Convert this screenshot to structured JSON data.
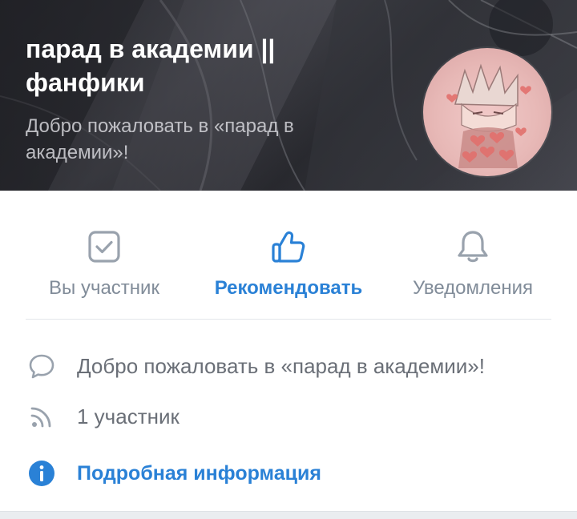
{
  "header": {
    "title": "парад в академии || фанфики",
    "subtitle": "Добро пожаловать в «парад в академии»!"
  },
  "actions": {
    "member_label": "Вы участник",
    "recommend_label": "Рекомендовать",
    "notifications_label": "Уведомления"
  },
  "info": {
    "description": "Добро пожаловать в «парад в академии»!",
    "members": "1 участник",
    "more_info": "Подробная информация"
  },
  "colors": {
    "accent": "#2a81d6",
    "icon_gray": "#99a2ad",
    "text_gray": "#818c99"
  },
  "icons": {
    "member": "checkbox-checked-icon",
    "recommend": "thumbs-up-icon",
    "notifications": "bell-icon",
    "description": "speech-bubble-icon",
    "members": "rss-icon",
    "more_info": "info-icon"
  }
}
